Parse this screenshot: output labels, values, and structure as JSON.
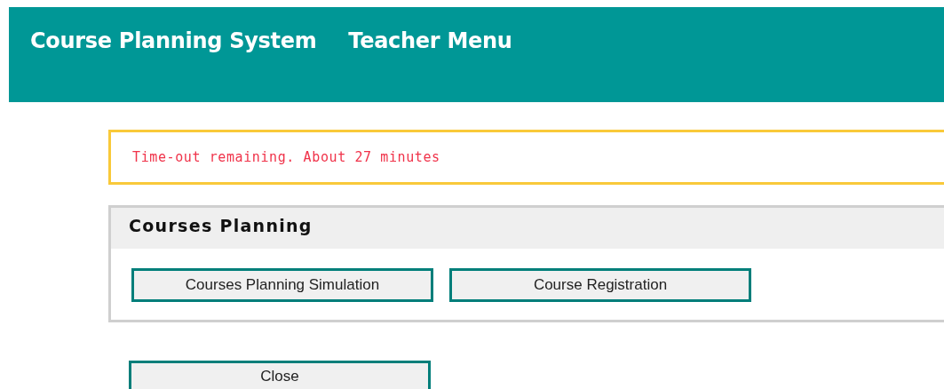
{
  "header": {
    "system_title": "Course Planning System",
    "menu_title": "Teacher Menu"
  },
  "notice": "Time-out remaining. About 27 minutes",
  "panel": {
    "title": "Courses Planning",
    "buttons": [
      "Courses Planning Simulation",
      "Course Registration"
    ]
  },
  "close_button": "Close"
}
